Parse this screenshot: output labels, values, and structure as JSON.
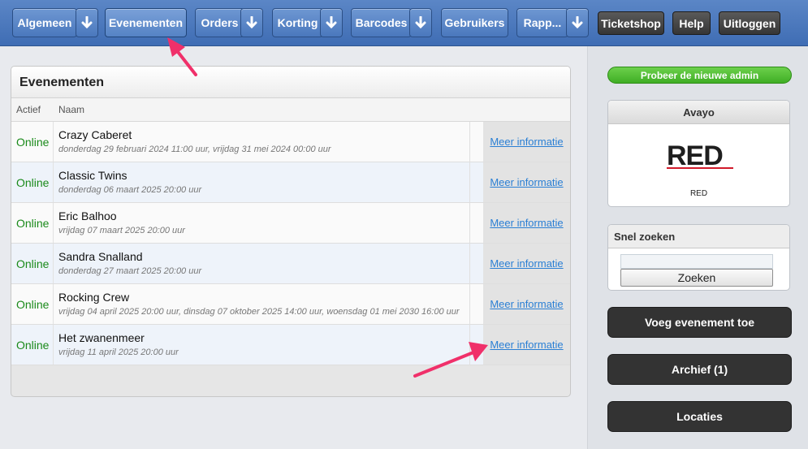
{
  "nav": {
    "items": [
      {
        "label": "Algemeen",
        "has_dropdown": true
      },
      {
        "label": "Evenementen",
        "has_dropdown": false,
        "active": true
      },
      {
        "label": "Orders",
        "has_dropdown": true
      },
      {
        "label": "Korting",
        "has_dropdown": true
      },
      {
        "label": "Barcodes",
        "has_dropdown": true
      },
      {
        "label": "Gebruikers",
        "has_dropdown": false
      },
      {
        "label": "Rapp...",
        "has_dropdown": true
      }
    ],
    "right": {
      "ticketshop": "Ticketshop",
      "help": "Help",
      "logout": "Uitloggen"
    }
  },
  "events_panel": {
    "title": "Evenementen",
    "columns": {
      "status": "Actief",
      "name": "Naam"
    },
    "rows": [
      {
        "status": "Online",
        "name": "Crazy Caberet",
        "dates": "donderdag 29 februari 2024 11:00 uur, vrijdag 31 mei 2024 00:00 uur",
        "link": "Meer informatie"
      },
      {
        "status": "Online",
        "name": "Classic Twins",
        "dates": "donderdag 06 maart 2025 20:00 uur",
        "link": "Meer informatie"
      },
      {
        "status": "Online",
        "name": "Eric Balhoo",
        "dates": "vrijdag 07 maart 2025 20:00 uur",
        "link": "Meer informatie"
      },
      {
        "status": "Online",
        "name": "Sandra Snalland",
        "dates": "donderdag 27 maart 2025 20:00 uur",
        "link": "Meer informatie"
      },
      {
        "status": "Online",
        "name": "Rocking Crew",
        "dates": "vrijdag 04 april 2025 20:00 uur, dinsdag 07 oktober 2025 14:00 uur, woensdag 01 mei 2030 16:00 uur",
        "link": "Meer informatie"
      },
      {
        "status": "Online",
        "name": "Het zwanenmeer",
        "dates": "vrijdag 11 april 2025 20:00 uur",
        "link": "Meer informatie"
      }
    ]
  },
  "sidebar": {
    "try_new_admin": "Probeer de nieuwe admin",
    "org_box": {
      "title": "Avayo",
      "logo_text": "RED",
      "org_name": "RED"
    },
    "quick_search": {
      "title": "Snel zoeken",
      "input_value": "",
      "button": "Zoeken"
    },
    "add_event": "Voeg evenement toe",
    "archive": "Archief (1)",
    "locations": "Locaties"
  },
  "colors": {
    "nav_blue": "#4a78bd",
    "online_green": "#1a8a1a",
    "link_blue": "#2a7fd4",
    "annotation_pink": "#f0306a",
    "logo_red": "#d11a2a"
  }
}
